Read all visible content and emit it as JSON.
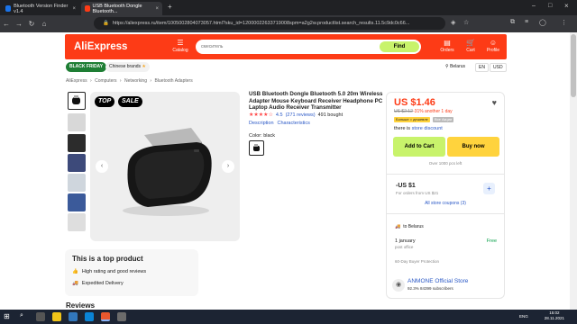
{
  "browser": {
    "tabs": [
      {
        "label": "Bluetooth Version Finder v1.4"
      },
      {
        "label": "USB Bluetooth Dongle Bluetooth..."
      }
    ],
    "new_tab": "+",
    "url": "https://aliexpress.ru/item/1005002804073057.html?sku_id=12000022633719008spm=a2g2w.productlist.search_results.11.5c9dc0c66..."
  },
  "header": {
    "logo": "AliExpress",
    "catalog_label": "Catalog",
    "search_placeholder": "смеситель",
    "find_label": "Find",
    "orders_label": "Orders",
    "cart_label": "Cart",
    "profile_label": "Profile"
  },
  "subheader": {
    "black_friday": "BLACK FRIDAY",
    "chinese_brands": "Chinese brands",
    "region": "Belarus",
    "language": "EN",
    "currency": "USD"
  },
  "breadcrumb": [
    "AliExpress",
    "›",
    "Computers",
    "›",
    "Networking",
    "›",
    "Bluetooth Adapters"
  ],
  "gallery": {
    "badge_top": "TOP",
    "badge_sale": "SALE",
    "prev": "‹",
    "next": "›"
  },
  "product": {
    "title": "USB Bluetooth Dongle Bluetooth 5.0 20m Wireless Adapter Mouse Keyboard Receiver Headphone PC Laptop Audio Receiver Transmitter",
    "rating": "4.5",
    "reviews": "(271 reviews)",
    "sold": "491 bought",
    "tab_description": "Description",
    "tab_characteristics": "Characteristics",
    "color_label": "Color: black"
  },
  "top_product": {
    "title": "This is a top product",
    "feature_1": "High rating and good reviews",
    "feature_2": "Expedited Delivery"
  },
  "reviews_heading": "Reviews",
  "buy": {
    "price": "US $1.46",
    "old_price": "US $2.12",
    "discount": "-31% another 1 day",
    "tag_1": "Больше = дешевле",
    "tag_2": "Все Акции",
    "store_discount_prefix": "there is",
    "store_discount_link": "store discount",
    "add_to_cart": "Add to Cart",
    "buy_now": "Buy now",
    "over_sold": "Over 1000 pcs left",
    "coupon_amount": "-US $1",
    "coupon_condition": "For orders from US $21",
    "coupon_plus": "+",
    "all_coupons": "All store coupons (3)",
    "ship_to": "to Belarus",
    "ship_date": "1 january",
    "ship_method": "post office",
    "ship_free": "Free",
    "buyer_protection": "60-Day Buyer Protection",
    "store_name": "ANMONE Official Store",
    "store_stats": "92.3%   84399 subscribers"
  },
  "taskbar": {
    "time": "15:02",
    "date": "28.11.2021",
    "lang": "ENG"
  },
  "colors": {
    "brand_red": "#fd3b16",
    "find_green": "#c8f36b",
    "add_to_cart": "#c8f36b",
    "buy_now": "#ffd33d",
    "link_blue": "#2a58c6"
  }
}
